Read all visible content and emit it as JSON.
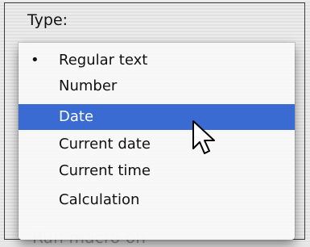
{
  "type_label": "Type:",
  "menu": {
    "items": [
      {
        "label": "Regular text",
        "checked": true
      },
      {
        "label": "Number"
      },
      {
        "label": "Date",
        "highlighted": true
      },
      {
        "label": "Current date"
      },
      {
        "label": "Current time"
      },
      {
        "label": "Calculation"
      }
    ],
    "check_glyph": "•"
  },
  "behind_text": "Run macro on",
  "colors": {
    "highlight": "#3a6bd2"
  },
  "cursor_icon": "arrow-cursor-icon"
}
